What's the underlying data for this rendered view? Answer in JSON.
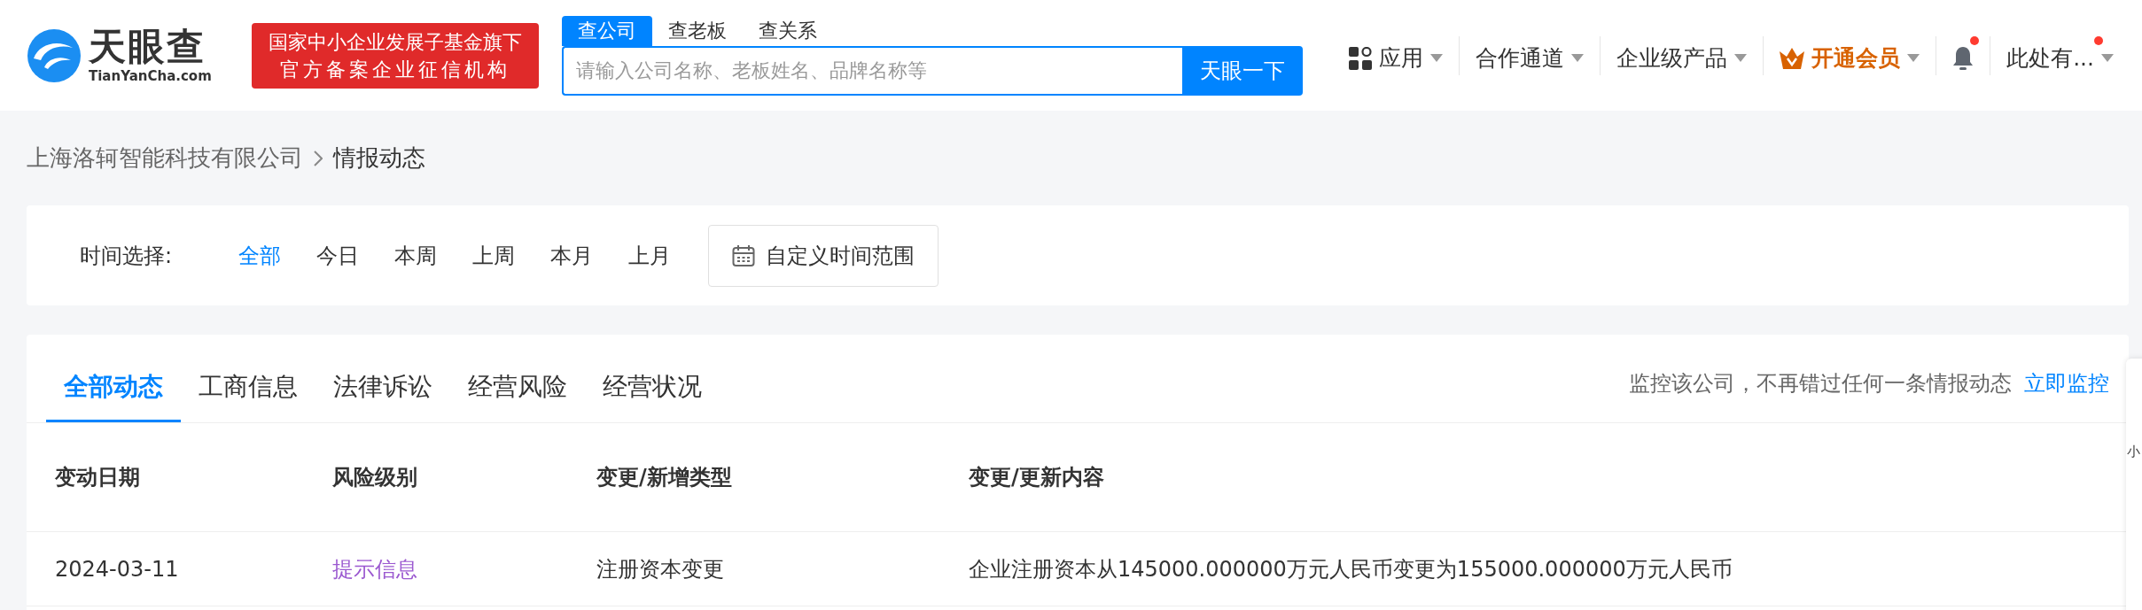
{
  "logo": {
    "name": "天眼查",
    "domain": "TianYanCha.com"
  },
  "badge": {
    "lines": [
      "国家中小企业发展子基金旗下",
      "官方备案企业征信机构"
    ]
  },
  "search": {
    "tabs": [
      {
        "label": "查公司",
        "selected": true
      },
      {
        "label": "查老板",
        "selected": false
      },
      {
        "label": "查关系",
        "selected": false
      }
    ],
    "placeholder": "请输入公司名称、老板姓名、品牌名称等",
    "button": "天眼一下"
  },
  "nav": [
    {
      "kind": "apps",
      "label": "应用",
      "notification": false
    },
    {
      "kind": "plain",
      "label": "合作通道",
      "notification": false
    },
    {
      "kind": "plain",
      "label": "企业级产品",
      "notification": false
    },
    {
      "kind": "vip",
      "label": "开通会员",
      "notification": false
    },
    {
      "kind": "bell",
      "notification": true
    },
    {
      "kind": "plain",
      "label": "此处有...",
      "notification": true
    }
  ],
  "breadcrumb": [
    {
      "label": "上海洛轲智能科技有限公司"
    },
    {
      "label": "情报动态"
    }
  ],
  "time_filter": {
    "label": "时间选择:",
    "options": [
      {
        "label": "全部",
        "selected": true
      },
      {
        "label": "今日",
        "selected": false
      },
      {
        "label": "本周",
        "selected": false
      },
      {
        "label": "上周",
        "selected": false
      },
      {
        "label": "本月",
        "selected": false
      },
      {
        "label": "上月",
        "selected": false
      }
    ],
    "custom_range": "自定义时间范围"
  },
  "tabs": [
    {
      "label": "全部动态",
      "selected": true
    },
    {
      "label": "工商信息",
      "selected": false
    },
    {
      "label": "法律诉讼",
      "selected": false
    },
    {
      "label": "经营风险",
      "selected": false
    },
    {
      "label": "经营状况",
      "selected": false
    }
  ],
  "monitor": {
    "text": "监控该公司，不再错过任何一条情报动态",
    "link": "立即监控"
  },
  "table": {
    "columns": [
      "变动日期",
      "风险级别",
      "变更/新增类型",
      "变更/更新内容"
    ],
    "rows": [
      {
        "date": "2024-03-11",
        "risk": "提示信息",
        "type": "注册资本变更",
        "content": "企业注册资本从145000.000000万元人民币变更为155000.000000万元人民币"
      }
    ]
  },
  "side_panel": {
    "label": "小"
  }
}
